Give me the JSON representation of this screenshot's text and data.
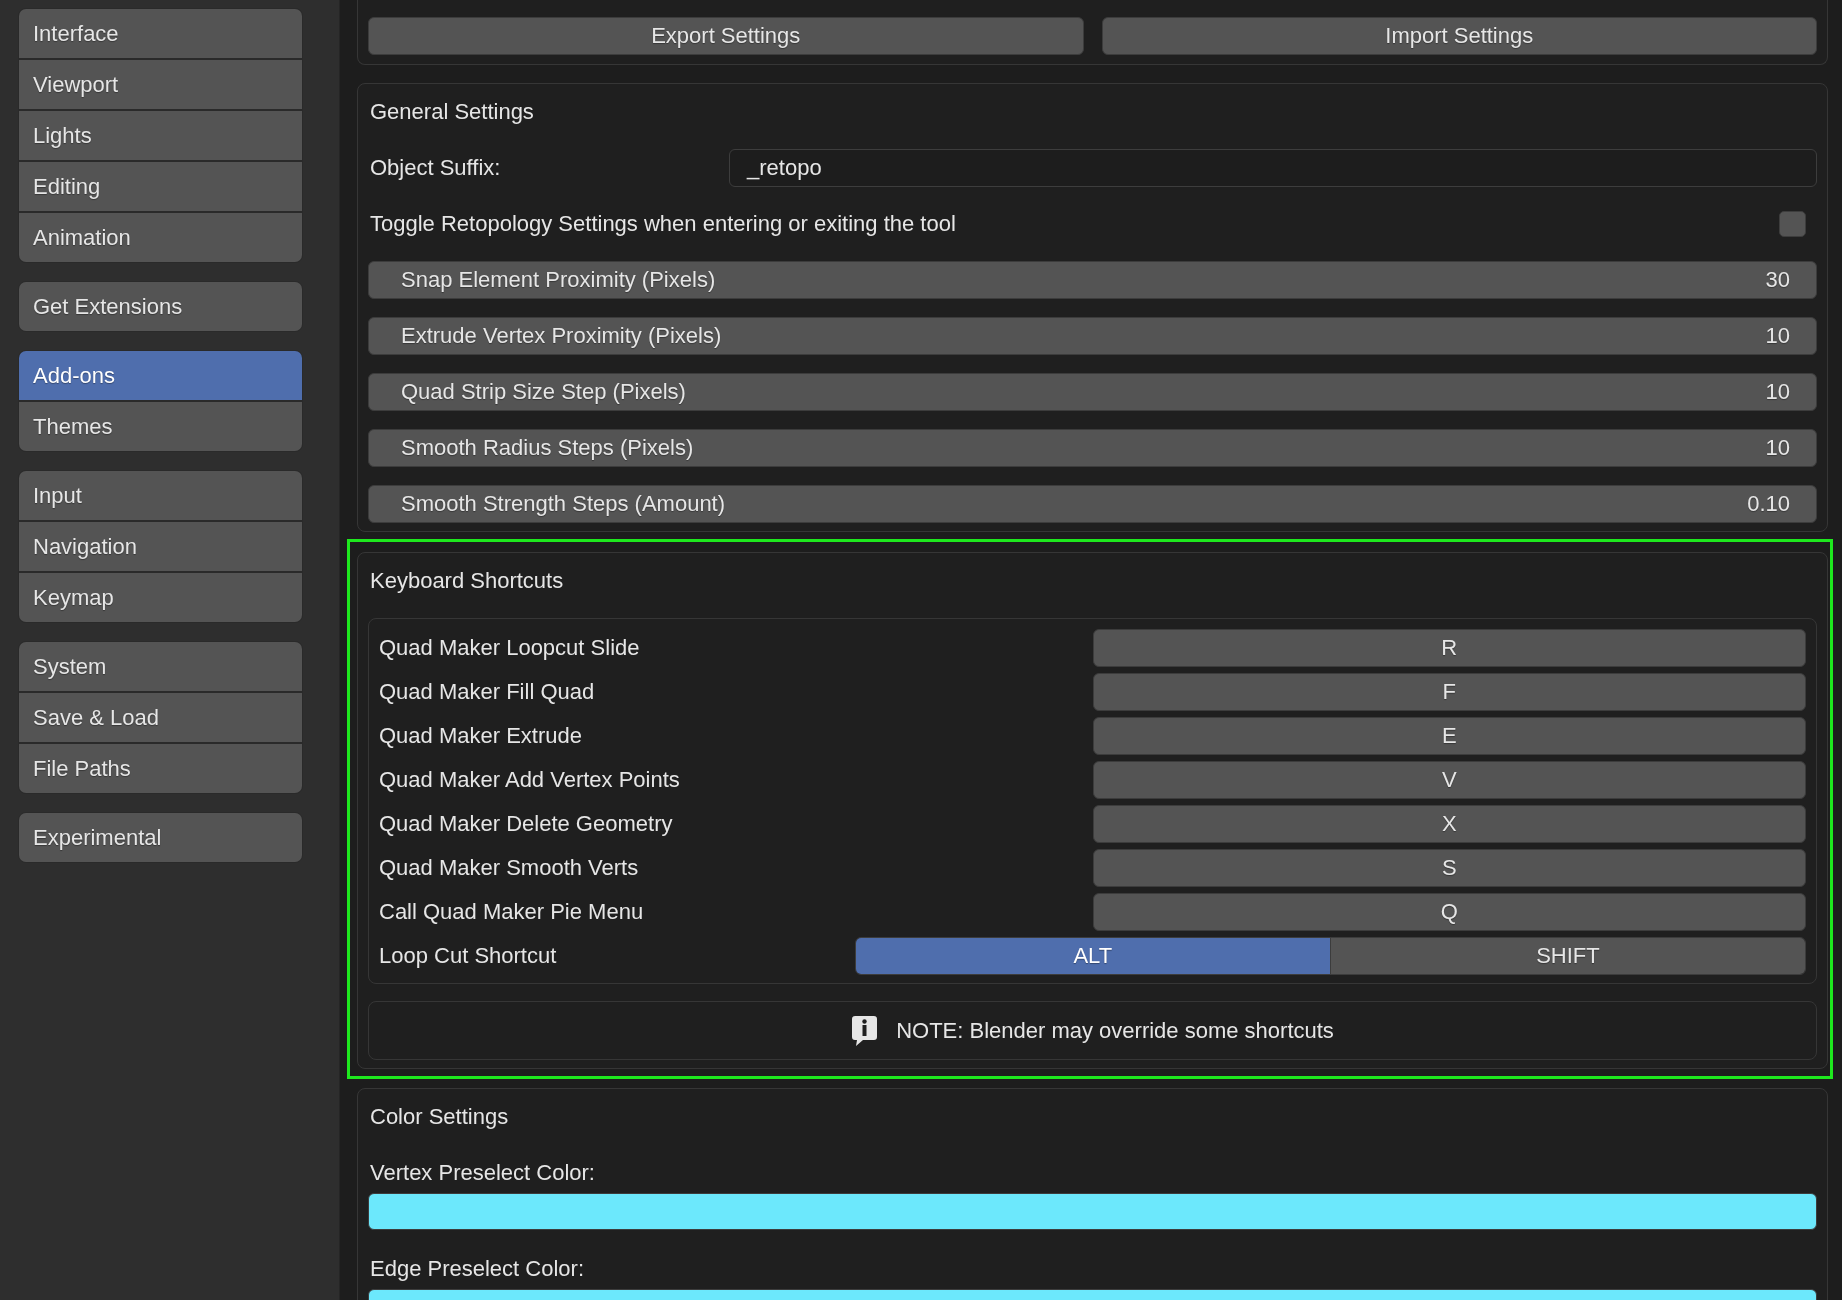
{
  "sidebar": {
    "groups": [
      {
        "items": [
          {
            "label": "Interface",
            "selected": false
          },
          {
            "label": "Viewport",
            "selected": false
          },
          {
            "label": "Lights",
            "selected": false
          },
          {
            "label": "Editing",
            "selected": false
          },
          {
            "label": "Animation",
            "selected": false
          }
        ]
      },
      {
        "items": [
          {
            "label": "Get Extensions",
            "selected": false
          }
        ]
      },
      {
        "items": [
          {
            "label": "Add-ons",
            "selected": true
          },
          {
            "label": "Themes",
            "selected": false
          }
        ]
      },
      {
        "items": [
          {
            "label": "Input",
            "selected": false
          },
          {
            "label": "Navigation",
            "selected": false
          },
          {
            "label": "Keymap",
            "selected": false
          }
        ]
      },
      {
        "items": [
          {
            "label": "System",
            "selected": false
          },
          {
            "label": "Save & Load",
            "selected": false
          },
          {
            "label": "File Paths",
            "selected": false
          }
        ]
      },
      {
        "items": [
          {
            "label": "Experimental",
            "selected": false
          }
        ]
      }
    ]
  },
  "settings_actions": {
    "buttons": [
      "Export Settings",
      "Import Settings"
    ]
  },
  "general_settings": {
    "title": "General Settings",
    "object_suffix": {
      "label": "Object Suffix:",
      "value": "_retopo"
    },
    "toggle": {
      "label": "Toggle Retopology Settings when entering or exiting the tool",
      "checked": false
    },
    "number_fields": [
      {
        "label": "Snap Element Proximity (Pixels)",
        "value": "30"
      },
      {
        "label": "Extrude Vertex Proximity (Pixels)",
        "value": "10"
      },
      {
        "label": "Quad Strip Size Step (Pixels)",
        "value": "10"
      },
      {
        "label": "Smooth Radius Steps (Pixels)",
        "value": "10"
      },
      {
        "label": "Smooth Strength Steps (Amount)",
        "value": "0.10"
      }
    ]
  },
  "keyboard_shortcuts": {
    "highlighted": true,
    "title": "Keyboard Shortcuts",
    "rows": [
      {
        "kind": "key",
        "label": "Quad Maker Loopcut Slide",
        "key": "R"
      },
      {
        "kind": "key",
        "label": "Quad Maker Fill Quad",
        "key": "F"
      },
      {
        "kind": "key",
        "label": "Quad Maker Extrude",
        "key": "E"
      },
      {
        "kind": "key",
        "label": "Quad Maker Add Vertex Points",
        "key": "V"
      },
      {
        "kind": "key",
        "label": "Quad Maker Delete Geometry",
        "key": "X"
      },
      {
        "kind": "key",
        "label": "Quad Maker Smooth Verts",
        "key": "S"
      },
      {
        "kind": "key",
        "label": "Call Quad Maker Pie Menu",
        "key": "Q"
      },
      {
        "kind": "choice",
        "label": "Loop Cut Shortcut",
        "options": [
          {
            "label": "ALT",
            "selected": true
          },
          {
            "label": "SHIFT",
            "selected": false
          }
        ]
      }
    ],
    "note": "NOTE: Blender may override some shortcuts"
  },
  "color_settings": {
    "title": "Color Settings",
    "colors": [
      {
        "label": "Vertex Preselect Color:",
        "color": "#6ce8fc"
      },
      {
        "label": "Edge Preselect Color:",
        "color": "#6ce8fc"
      }
    ]
  }
}
